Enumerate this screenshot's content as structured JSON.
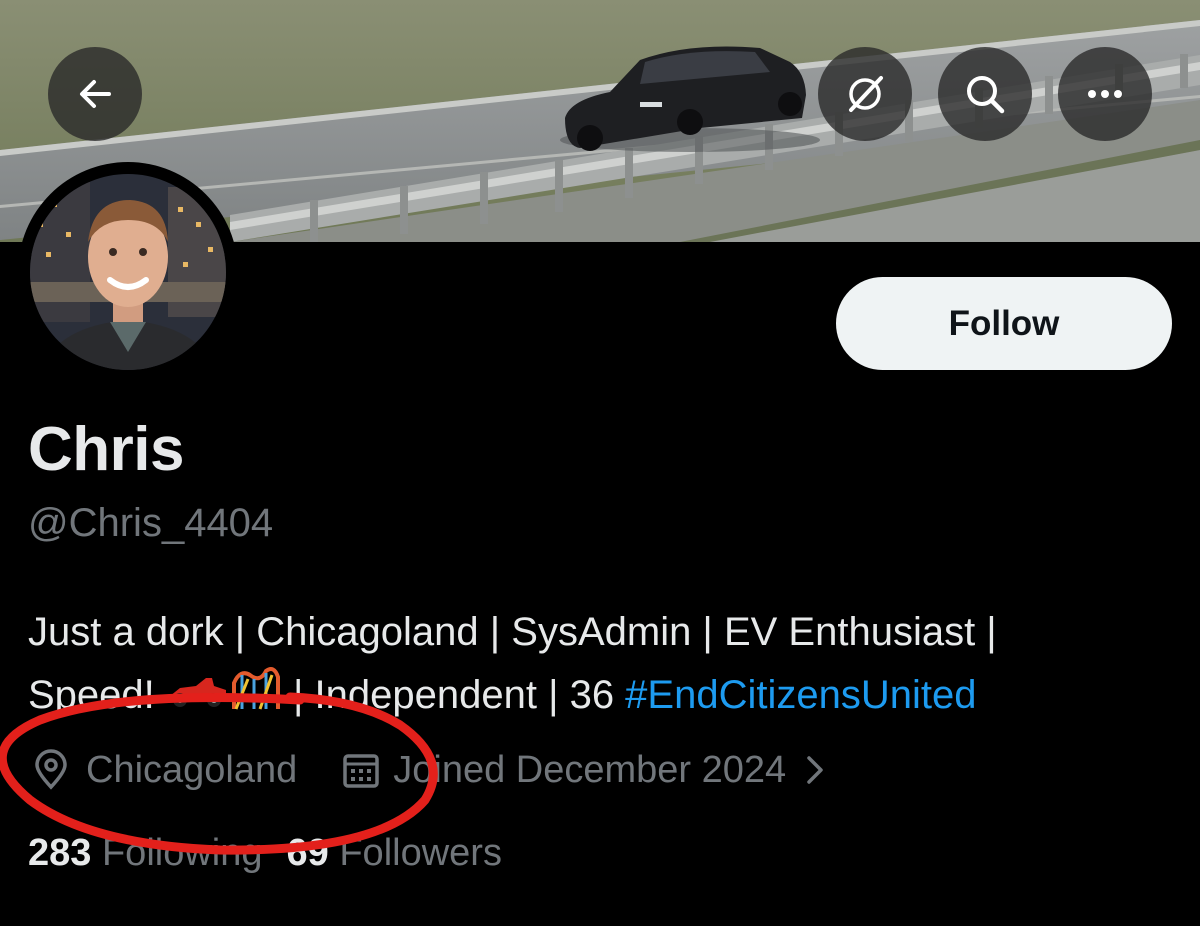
{
  "header": {
    "back_icon": "arrow-left-icon",
    "grok_icon": "grok-icon",
    "search_icon": "search-icon",
    "more_icon": "more-icon"
  },
  "profile": {
    "name": "Chris",
    "handle": "@Chris_4404",
    "follow_label": "Follow",
    "bio_line1": "Just a dork | Chicagoland | SysAdmin | EV Enthusiast |",
    "bio_line2_start": "Speed! ",
    "bio_line2_middle": " | Independent | 36 ",
    "bio_hashtag": "#EndCitizensUnited",
    "location": "Chicagoland",
    "joined": "Joined December 2024",
    "following_count": "283",
    "following_label": "Following",
    "followers_count": "69",
    "followers_label": "Followers"
  },
  "colors": {
    "background": "#000000",
    "text_primary": "#e7e9ea",
    "text_secondary": "#71767b",
    "link": "#1d9bf0",
    "annotation": "#e3201b"
  }
}
